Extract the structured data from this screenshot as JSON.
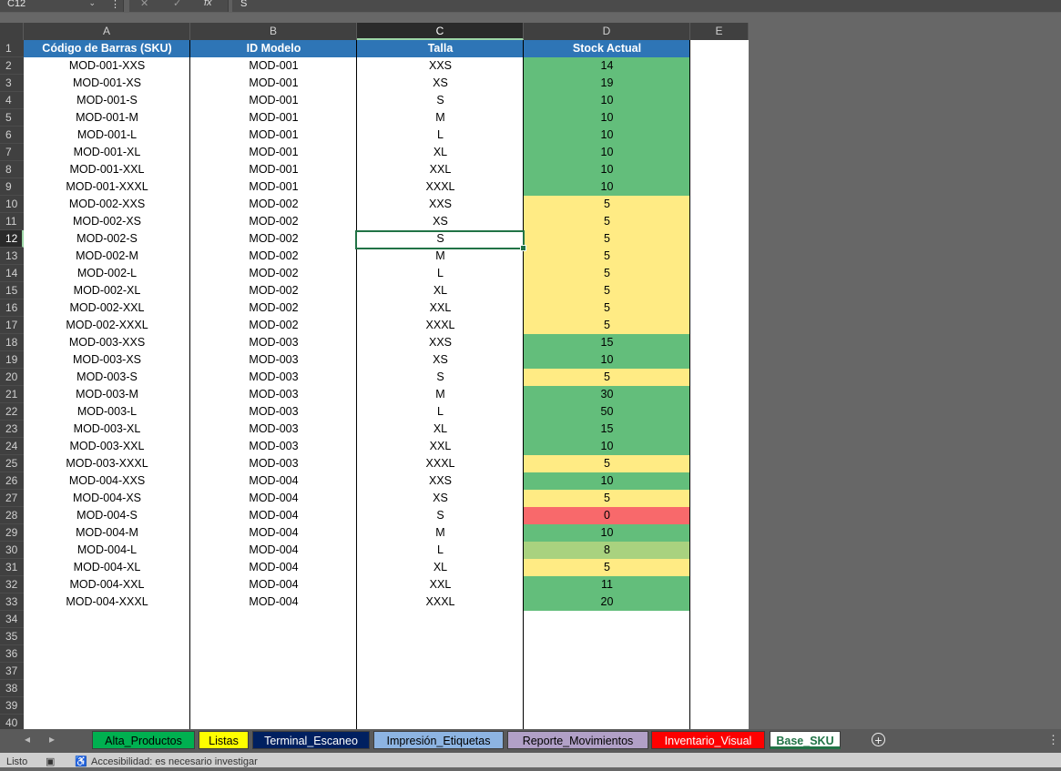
{
  "formula_bar": {
    "name_box": "C12",
    "fx_label": "fx",
    "cancel_glyph": "✕",
    "enter_glyph": "✓",
    "formula_value": "S"
  },
  "columns": [
    "A",
    "B",
    "C",
    "D",
    "E"
  ],
  "selected_column": "C",
  "selected_row": 12,
  "row_numbers": [
    1,
    2,
    3,
    4,
    5,
    6,
    7,
    8,
    9,
    10,
    11,
    12,
    13,
    14,
    15,
    16,
    17,
    18,
    19,
    20,
    21,
    22,
    23,
    24,
    25,
    26,
    27,
    28,
    29,
    30,
    31,
    32,
    33,
    34,
    35,
    36,
    37,
    38,
    39,
    40
  ],
  "headers": [
    "Código de Barras (SKU)",
    "ID Modelo",
    "Talla",
    "Stock Actual"
  ],
  "stock_colors": {
    "high": "#63be7b",
    "medium": "#ffeb84",
    "mid_high": "#a9d27f",
    "zero": "#f8696b"
  },
  "rows": [
    {
      "sku": "MOD-001-XXS",
      "model": "MOD-001",
      "size": "XXS",
      "stock": "14",
      "level": "high"
    },
    {
      "sku": "MOD-001-XS",
      "model": "MOD-001",
      "size": "XS",
      "stock": "19",
      "level": "high"
    },
    {
      "sku": "MOD-001-S",
      "model": "MOD-001",
      "size": "S",
      "stock": "10",
      "level": "high"
    },
    {
      "sku": "MOD-001-M",
      "model": "MOD-001",
      "size": "M",
      "stock": "10",
      "level": "high"
    },
    {
      "sku": "MOD-001-L",
      "model": "MOD-001",
      "size": "L",
      "stock": "10",
      "level": "high"
    },
    {
      "sku": "MOD-001-XL",
      "model": "MOD-001",
      "size": "XL",
      "stock": "10",
      "level": "high"
    },
    {
      "sku": "MOD-001-XXL",
      "model": "MOD-001",
      "size": "XXL",
      "stock": "10",
      "level": "high"
    },
    {
      "sku": "MOD-001-XXXL",
      "model": "MOD-001",
      "size": "XXXL",
      "stock": "10",
      "level": "high"
    },
    {
      "sku": "MOD-002-XXS",
      "model": "MOD-002",
      "size": "XXS",
      "stock": "5",
      "level": "medium"
    },
    {
      "sku": "MOD-002-XS",
      "model": "MOD-002",
      "size": "XS",
      "stock": "5",
      "level": "medium"
    },
    {
      "sku": "MOD-002-S",
      "model": "MOD-002",
      "size": "S",
      "stock": "5",
      "level": "medium"
    },
    {
      "sku": "MOD-002-M",
      "model": "MOD-002",
      "size": "M",
      "stock": "5",
      "level": "medium"
    },
    {
      "sku": "MOD-002-L",
      "model": "MOD-002",
      "size": "L",
      "stock": "5",
      "level": "medium"
    },
    {
      "sku": "MOD-002-XL",
      "model": "MOD-002",
      "size": "XL",
      "stock": "5",
      "level": "medium"
    },
    {
      "sku": "MOD-002-XXL",
      "model": "MOD-002",
      "size": "XXL",
      "stock": "5",
      "level": "medium"
    },
    {
      "sku": "MOD-002-XXXL",
      "model": "MOD-002",
      "size": "XXXL",
      "stock": "5",
      "level": "medium"
    },
    {
      "sku": "MOD-003-XXS",
      "model": "MOD-003",
      "size": "XXS",
      "stock": "15",
      "level": "high"
    },
    {
      "sku": "MOD-003-XS",
      "model": "MOD-003",
      "size": "XS",
      "stock": "10",
      "level": "high"
    },
    {
      "sku": "MOD-003-S",
      "model": "MOD-003",
      "size": "S",
      "stock": "5",
      "level": "medium"
    },
    {
      "sku": "MOD-003-M",
      "model": "MOD-003",
      "size": "M",
      "stock": "30",
      "level": "high"
    },
    {
      "sku": "MOD-003-L",
      "model": "MOD-003",
      "size": "L",
      "stock": "50",
      "level": "high"
    },
    {
      "sku": "MOD-003-XL",
      "model": "MOD-003",
      "size": "XL",
      "stock": "15",
      "level": "high"
    },
    {
      "sku": "MOD-003-XXL",
      "model": "MOD-003",
      "size": "XXL",
      "stock": "10",
      "level": "high"
    },
    {
      "sku": "MOD-003-XXXL",
      "model": "MOD-003",
      "size": "XXXL",
      "stock": "5",
      "level": "medium"
    },
    {
      "sku": "MOD-004-XXS",
      "model": "MOD-004",
      "size": "XXS",
      "stock": "10",
      "level": "high"
    },
    {
      "sku": "MOD-004-XS",
      "model": "MOD-004",
      "size": "XS",
      "stock": "5",
      "level": "medium"
    },
    {
      "sku": "MOD-004-S",
      "model": "MOD-004",
      "size": "S",
      "stock": "0",
      "level": "zero"
    },
    {
      "sku": "MOD-004-M",
      "model": "MOD-004",
      "size": "M",
      "stock": "10",
      "level": "high"
    },
    {
      "sku": "MOD-004-L",
      "model": "MOD-004",
      "size": "L",
      "stock": "8",
      "level": "mid_high"
    },
    {
      "sku": "MOD-004-XL",
      "model": "MOD-004",
      "size": "XL",
      "stock": "5",
      "level": "medium"
    },
    {
      "sku": "MOD-004-XXL",
      "model": "MOD-004",
      "size": "XXL",
      "stock": "11",
      "level": "high"
    },
    {
      "sku": "MOD-004-XXXL",
      "model": "MOD-004",
      "size": "XXXL",
      "stock": "20",
      "level": "high"
    }
  ],
  "sheet_tabs": [
    {
      "label": "Alta_Productos",
      "bg": "#00b050",
      "fg": "#000000"
    },
    {
      "label": "Listas",
      "bg": "#ffff00",
      "fg": "#000000"
    },
    {
      "label": "Terminal_Escaneo",
      "bg": "#002060",
      "fg": "#ffffff"
    },
    {
      "label": "Impresión_Etiquetas",
      "bg": "#8db4e2",
      "fg": "#000000"
    },
    {
      "label": "Reporte_Movimientos",
      "bg": "#b1a0c7",
      "fg": "#000000"
    },
    {
      "label": "Inventario_Visual",
      "bg": "#ff0000",
      "fg": "#ffffff"
    },
    {
      "label": "Base_SKU",
      "bg": "#ffffff",
      "fg": "#217346",
      "active": true
    }
  ],
  "status_bar": {
    "ready": "Listo",
    "accessibility": "Accesibilidad: es necesario investigar"
  }
}
